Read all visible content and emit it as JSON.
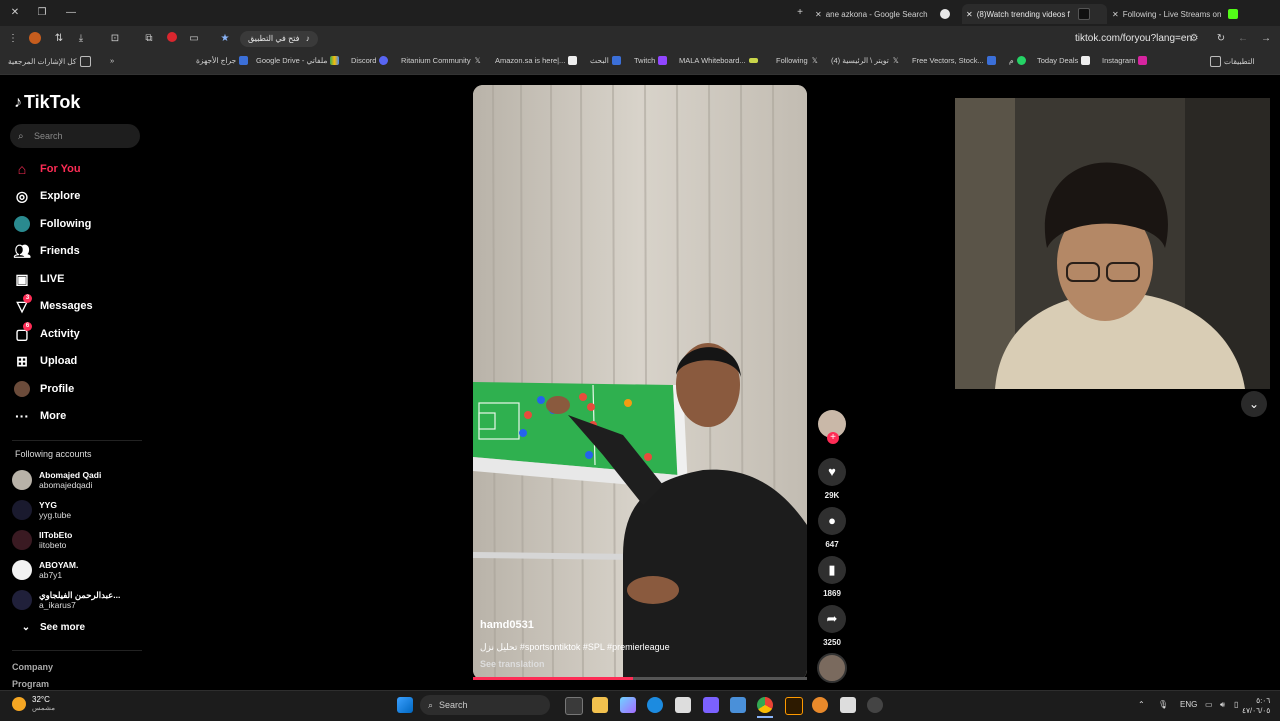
{
  "browser": {
    "tabs": [
      {
        "title": "ane azkona - Google Search",
        "active": false
      },
      {
        "title": "(8)Watch trending videos f",
        "active": true
      },
      {
        "title": "Following - Live Streams on Ki",
        "active": false
      }
    ],
    "url": "tiktok.com/foryou?lang=en",
    "open_in_app": "فتح في التطبيق",
    "bookmarks": [
      "التطبيقات",
      "Instagram",
      "Today Deals",
      "م",
      "Free Vectors, Stock...",
      "(4) تويتر \\ الرئيسية",
      "Following",
      "MALA Whiteboard...",
      "Twitch",
      "البحث",
      "Amazon.sa is here|...",
      "Ritanium Community",
      "Discord",
      "Google Drive - ملفاتي",
      "جراج الأجهزة"
    ],
    "all_bookmarks": "كل الإشارات المرجعية"
  },
  "sidebar": {
    "logo": "TikTok",
    "search_placeholder": "Search",
    "nav": [
      {
        "label": "For You",
        "icon": "home-icon",
        "active": true
      },
      {
        "label": "Explore",
        "icon": "compass-icon"
      },
      {
        "label": "Following",
        "icon": "following-icon"
      },
      {
        "label": "Friends",
        "icon": "friends-icon"
      },
      {
        "label": "LIVE",
        "icon": "live-icon"
      },
      {
        "label": "Messages",
        "icon": "messages-icon",
        "badge": "3"
      },
      {
        "label": "Activity",
        "icon": "activity-icon",
        "badge": "6"
      },
      {
        "label": "Upload",
        "icon": "upload-icon"
      },
      {
        "label": "Profile",
        "icon": "profile-icon"
      },
      {
        "label": "More",
        "icon": "more-icon"
      }
    ],
    "following_header": "Following accounts",
    "accounts": [
      {
        "name": "Abomajed Qadi",
        "handle": "abomajedqadi"
      },
      {
        "name": "YYG",
        "handle": "yyg.tube"
      },
      {
        "name": "IITobEto",
        "handle": "iitobeto"
      },
      {
        "name": "ABOYAM.",
        "handle": "ab7y1"
      },
      {
        "name": "عبدالرحمن الفيلجاوي...",
        "handle": "a_ikarus7"
      }
    ],
    "see_more": "See more",
    "footer": [
      "Company",
      "Program"
    ]
  },
  "video": {
    "author": "hamd0531",
    "caption": "تحليل نزل #sportsontiktok #SPL #premierleague",
    "see_translation": "See translation",
    "progress": 0.48,
    "likes": "29K",
    "comments": "647",
    "saves": "1869",
    "shares": "3250"
  },
  "taskbar": {
    "weather_temp": "32°C",
    "weather_desc": "مشمس",
    "search": "Search",
    "lang": "ENG",
    "time": "٥:٠٦",
    "date": "٤٧/٠٦/٠٥"
  },
  "colors": {
    "accent": "#fe2c55"
  }
}
